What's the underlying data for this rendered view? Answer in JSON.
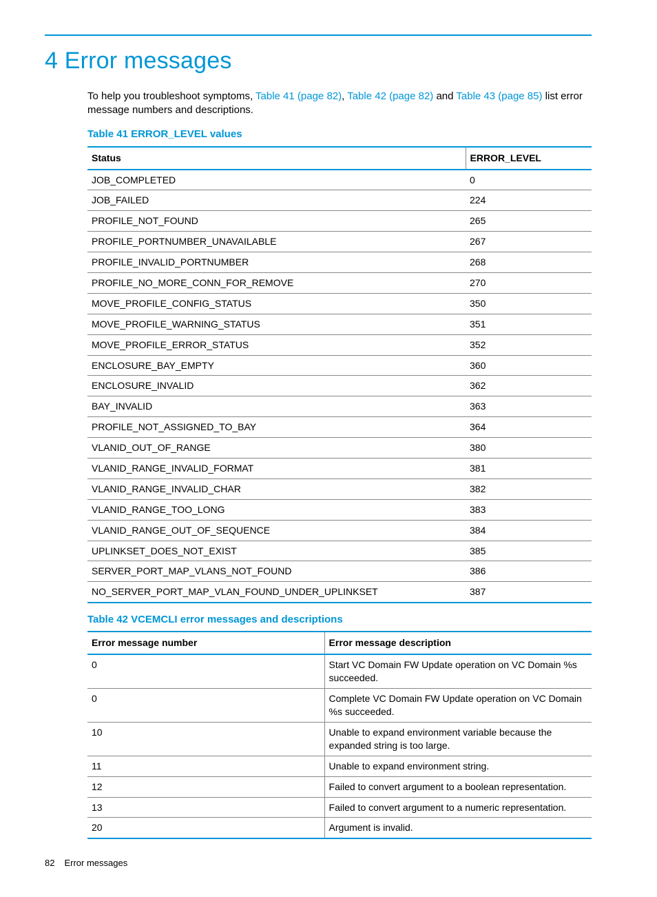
{
  "heading": "4 Error messages",
  "intro_parts": {
    "p1": "To help you troubleshoot symptoms, ",
    "l1": "Table 41 (page 82)",
    "c1": ", ",
    "l2": "Table 42 (page 82)",
    "c2": " and ",
    "l3": "Table 43 (page 85)",
    "p2": " list error message numbers and descriptions."
  },
  "table41": {
    "caption": "Table 41 ERROR_LEVEL values",
    "headers": [
      "Status",
      "ERROR_LEVEL"
    ],
    "rows": [
      [
        "JOB_COMPLETED",
        "0"
      ],
      [
        "JOB_FAILED",
        "224"
      ],
      [
        "PROFILE_NOT_FOUND",
        "265"
      ],
      [
        "PROFILE_PORTNUMBER_UNAVAILABLE",
        "267"
      ],
      [
        "PROFILE_INVALID_PORTNUMBER",
        "268"
      ],
      [
        "PROFILE_NO_MORE_CONN_FOR_REMOVE",
        "270"
      ],
      [
        "MOVE_PROFILE_CONFIG_STATUS",
        "350"
      ],
      [
        "MOVE_PROFILE_WARNING_STATUS",
        "351"
      ],
      [
        "MOVE_PROFILE_ERROR_STATUS",
        "352"
      ],
      [
        "ENCLOSURE_BAY_EMPTY",
        "360"
      ],
      [
        "ENCLOSURE_INVALID",
        "362"
      ],
      [
        "BAY_INVALID",
        "363"
      ],
      [
        "PROFILE_NOT_ASSIGNED_TO_BAY",
        "364"
      ],
      [
        "VLANID_OUT_OF_RANGE",
        "380"
      ],
      [
        "VLANID_RANGE_INVALID_FORMAT",
        "381"
      ],
      [
        "VLANID_RANGE_INVALID_CHAR",
        "382"
      ],
      [
        "VLANID_RANGE_TOO_LONG",
        "383"
      ],
      [
        "VLANID_RANGE_OUT_OF_SEQUENCE",
        "384"
      ],
      [
        "UPLINKSET_DOES_NOT_EXIST",
        "385"
      ],
      [
        "SERVER_PORT_MAP_VLANS_NOT_FOUND",
        "386"
      ],
      [
        "NO_SERVER_PORT_MAP_VLAN_FOUND_UNDER_UPLINKSET",
        "387"
      ]
    ]
  },
  "table42": {
    "caption": "Table 42 VCEMCLI error messages and descriptions",
    "headers": [
      "Error message number",
      "Error message description"
    ],
    "rows": [
      [
        "0",
        "Start VC Domain FW Update operation on VC Domain %s succeeded."
      ],
      [
        "0",
        "Complete VC Domain FW Update operation on VC Domain %s succeeded."
      ],
      [
        "10",
        "Unable to expand environment variable because the expanded string is too large."
      ],
      [
        "11",
        "Unable to expand environment string."
      ],
      [
        "12",
        "Failed to convert argument to a boolean representation."
      ],
      [
        "13",
        "Failed to convert argument to a numeric representation."
      ],
      [
        "20",
        "Argument is invalid."
      ]
    ]
  },
  "footer": {
    "page_number": "82",
    "title": "Error messages"
  }
}
